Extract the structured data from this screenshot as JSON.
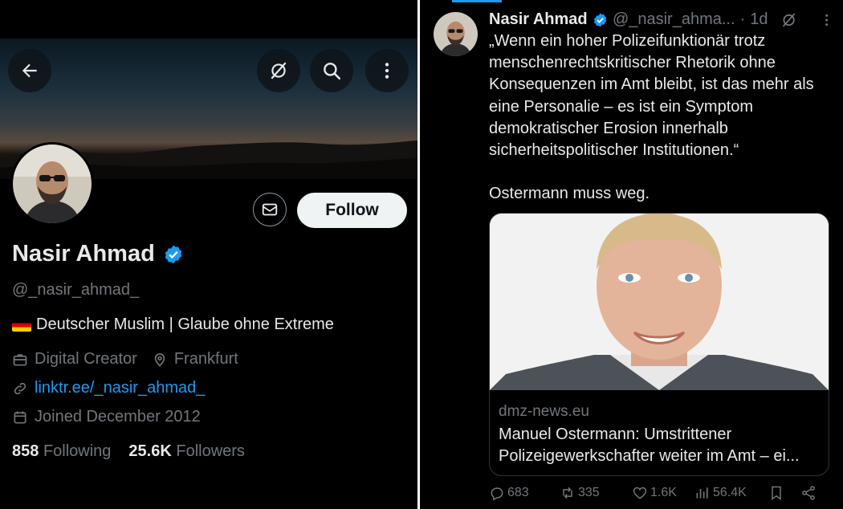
{
  "profile": {
    "name": "Nasir Ahmad",
    "handle": "@_nasir_ahmad_",
    "bio": "Deutscher Muslim | Glaube ohne Extreme",
    "category": "Digital Creator",
    "location": "Frankfurt",
    "link": "linktr.ee/_nasir_ahmad_",
    "joined": "Joined December 2012",
    "following_count": "858",
    "following_label": "Following",
    "followers_count": "25.6K",
    "followers_label": "Followers",
    "follow_label": "Follow"
  },
  "tweet": {
    "author_name": "Nasir Ahmad",
    "author_handle": "@_nasir_ahma...",
    "dot": "·",
    "time": "1d",
    "text_lines": [
      "„Wenn ein hoher Polizeifunktionär trotz",
      "menschenrechtskritischer Rhetorik ohne",
      "Konsequenzen im Amt bleibt, ist das mehr als",
      "eine Personalie – es ist ein Symptom",
      "demokratischer Erosion innerhalb",
      "sicherheitspolitischer Institutionen.“"
    ],
    "text_2": "Ostermann muss weg.",
    "card": {
      "domain": "dmz-news.eu",
      "title": "Manuel Ostermann: Umstrittener Polizeigewerkschafter weiter im Amt – ei..."
    },
    "stats": {
      "replies": "683",
      "reposts": "335",
      "likes": "1.6K",
      "views": "56.4K"
    }
  },
  "icons": [
    "back-arrow-icon",
    "grok-icon",
    "search-icon",
    "more-vertical-icon",
    "mail-icon",
    "verified-badge-icon",
    "briefcase-icon",
    "location-pin-icon",
    "link-icon",
    "calendar-icon",
    "reply-icon",
    "repost-icon",
    "like-icon",
    "views-icon",
    "bookmark-icon",
    "share-icon"
  ],
  "colors": {
    "accent": "#1d9bf0",
    "text": "#e7e9ea",
    "muted": "#71767b",
    "background": "#000000"
  }
}
